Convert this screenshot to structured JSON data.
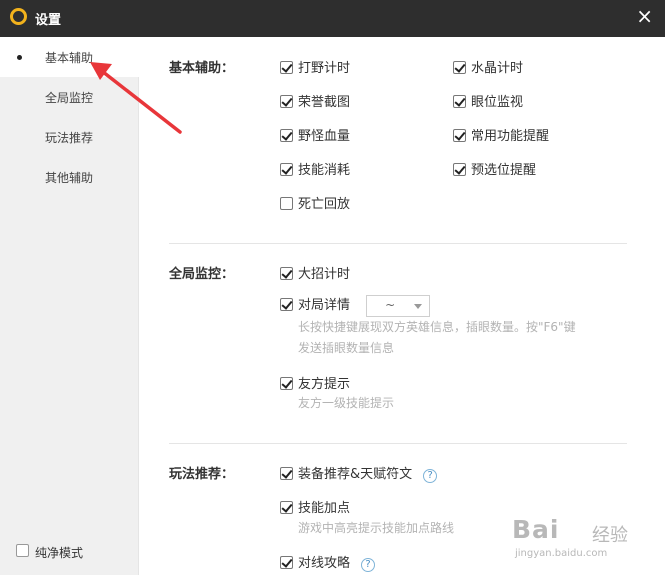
{
  "window": {
    "title": "设置",
    "close_label": "×",
    "logo_icon": "game-logo-icon"
  },
  "sidebar": {
    "items": [
      {
        "label": "基本辅助",
        "active": true
      },
      {
        "label": "全局监控"
      },
      {
        "label": "玩法推荐"
      },
      {
        "label": "其他辅助"
      }
    ],
    "pure_mode_label": "纯净模式"
  },
  "basic": {
    "title": "基本辅助：",
    "options": [
      {
        "label": "打野计时",
        "checked": true
      },
      {
        "label": "水晶计时",
        "checked": true
      },
      {
        "label": "荣誉截图",
        "checked": true
      },
      {
        "label": "眼位监视",
        "checked": true
      },
      {
        "label": "野怪血量",
        "checked": true
      },
      {
        "label": "常用功能提醒",
        "checked": true
      },
      {
        "label": "技能消耗",
        "checked": true
      },
      {
        "label": "预选位提醒",
        "checked": true
      },
      {
        "label": "死亡回放",
        "checked": false
      }
    ]
  },
  "global": {
    "title": "全局监控：",
    "ult_timer": "大招计时",
    "match_detail": "对局详情",
    "match_detail_select": "~",
    "match_detail_desc1": "长按快捷键展现双方英雄信息，插眼数量。按\"F6\"键",
    "match_detail_desc2": "发送插眼数量信息",
    "ally_tip": "友方提示",
    "ally_tip_desc": "友方一级技能提示"
  },
  "play": {
    "title": "玩法推荐：",
    "equip": "装备推荐&天赋符文",
    "skill_points": "技能加点",
    "skill_points_desc": "游戏中高亮提示技能加点路线",
    "lane": "对线攻略",
    "help_label": "?"
  },
  "watermark": {
    "brand": "Bai",
    "brand_cn": "经验",
    "url": "jingyan.baidu.com"
  },
  "colors": {
    "titlebar": "#2e2e2e",
    "logo": "#f2b21c",
    "arrow": "#e8363a"
  }
}
